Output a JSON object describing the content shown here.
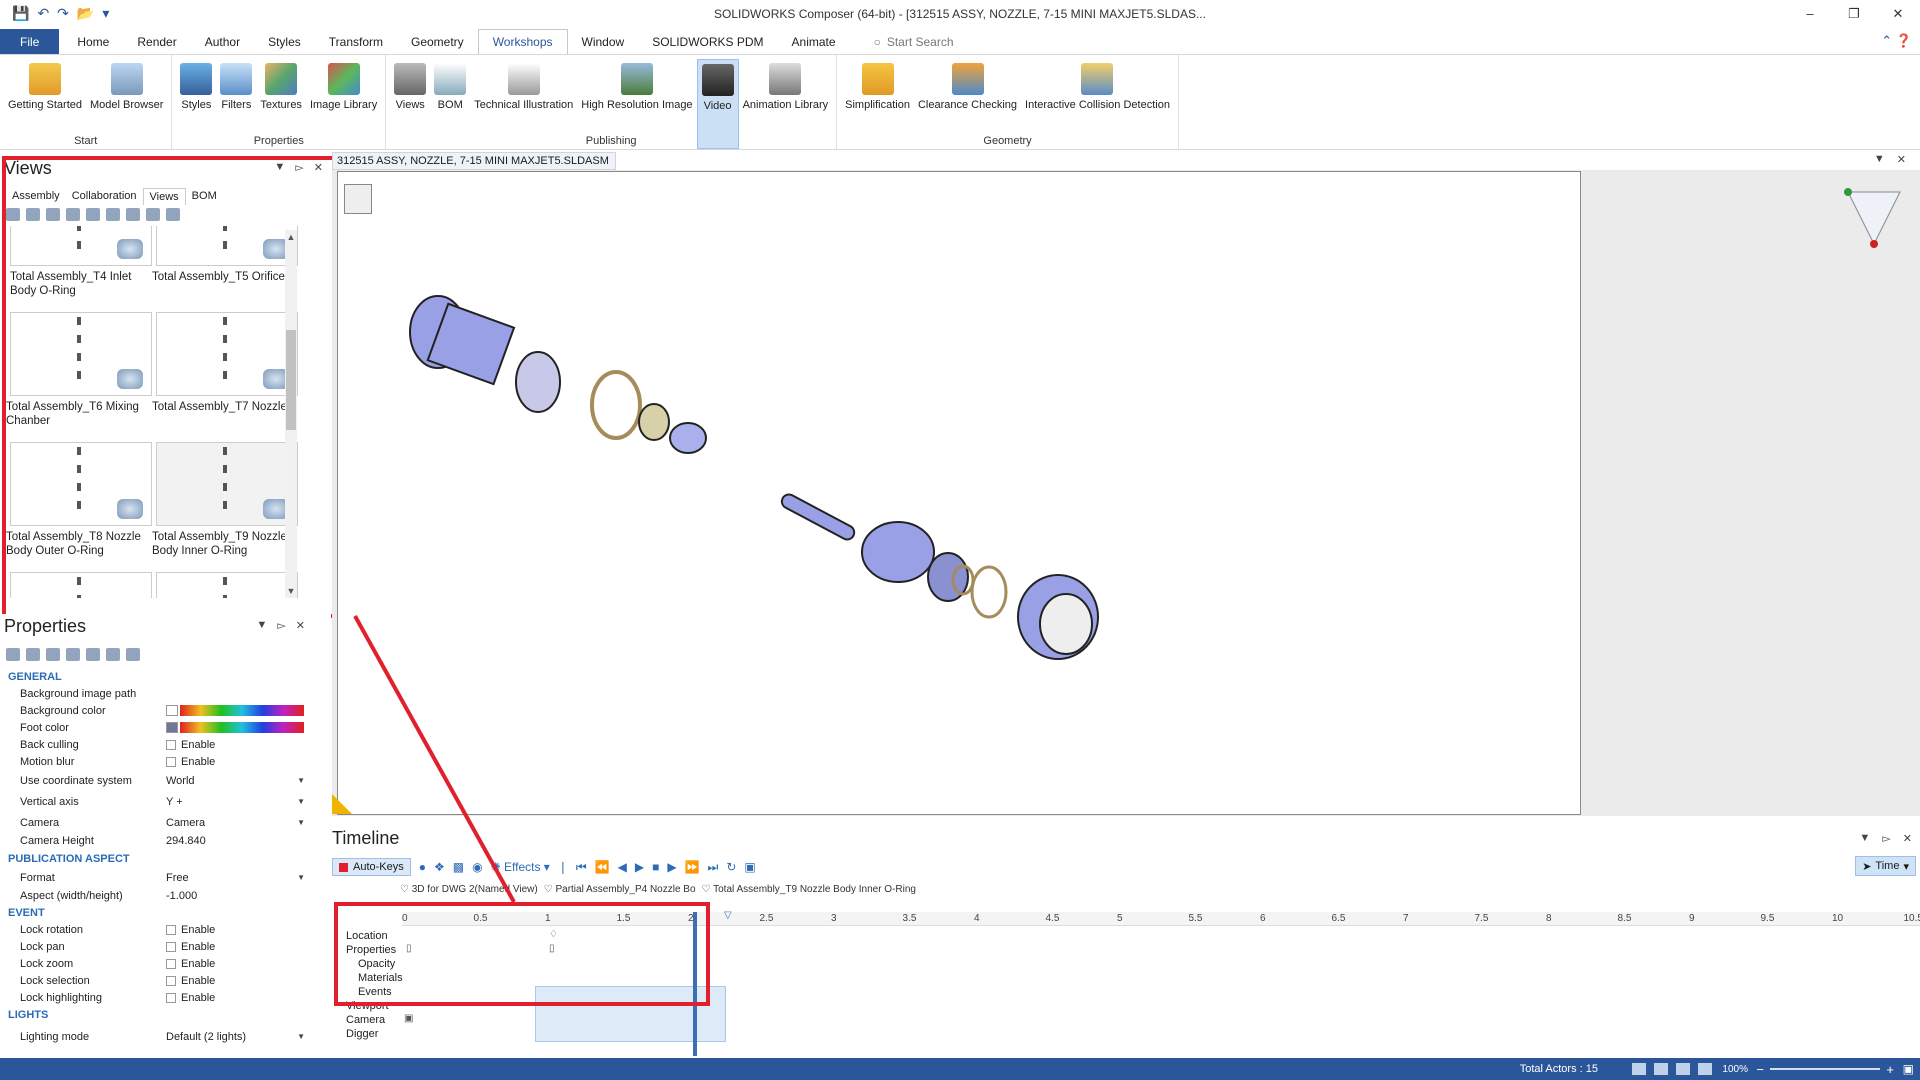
{
  "window": {
    "title": "SOLIDWORKS Composer (64-bit) - [312515 ASSY, NOZZLE, 7-15 MINI MAXJET5.SLDAS..."
  },
  "menu": {
    "tabs": [
      "File",
      "Home",
      "Render",
      "Author",
      "Styles",
      "Transform",
      "Geometry",
      "Workshops",
      "Window",
      "SOLIDWORKS PDM",
      "Animate"
    ],
    "search_placeholder": "Start Search"
  },
  "ribbon": {
    "groups": [
      {
        "label": "Start",
        "buttons": [
          "Getting Started",
          "Model Browser"
        ]
      },
      {
        "label": "Properties",
        "buttons": [
          "Styles",
          "Filters",
          "Textures",
          "Image Library"
        ]
      },
      {
        "label": "Publishing",
        "buttons": [
          "Views",
          "BOM",
          "Technical Illustration",
          "High Resolution Image",
          "Video",
          "Animation Library"
        ]
      },
      {
        "label": "Geometry",
        "buttons": [
          "Simplification",
          "Clearance Checking",
          "Interactive Collision Detection"
        ]
      }
    ]
  },
  "views_panel": {
    "title": "Views",
    "tabs": [
      "Assembly",
      "Collaboration",
      "Views",
      "BOM"
    ],
    "thumbnails": [
      "Total Assembly_T4 Inlet Body O-Ring",
      "Total Assembly_T5 Orifice",
      "Total Assembly_T6 Mixing Chanber",
      "Total Assembly_T7 Nozzle",
      "Total Assembly_T8 Nozzle Body Outer O-Ring",
      "Total Assembly_T9 Nozzle Body Inner O-Ring"
    ]
  },
  "properties_panel": {
    "title": "Properties",
    "sections": {
      "general": "GENERAL",
      "publication": "PUBLICATION ASPECT",
      "event": "EVENT",
      "lights": "LIGHTS"
    },
    "rows": {
      "bg_image_path": "Background image path",
      "bg_color": "Background color",
      "foot_color": "Foot color",
      "back_culling": "Back culling",
      "motion_blur": "Motion blur",
      "coord_system": "Use coordinate system",
      "coord_value": "World",
      "vertical_axis": "Vertical axis",
      "vertical_value": "Y +",
      "camera": "Camera",
      "camera_value": "Camera",
      "camera_height": "Camera Height",
      "camera_height_value": "294.840",
      "format": "Format",
      "format_value": "Free",
      "aspect": "Aspect (width/height)",
      "aspect_value": "-1.000",
      "lock_rotation": "Lock rotation",
      "lock_pan": "Lock pan",
      "lock_zoom": "Lock zoom",
      "lock_selection": "Lock selection",
      "lock_highlighting": "Lock highlighting",
      "lighting_mode": "Lighting mode",
      "lighting_value": "Default (2 lights)",
      "enable": "Enable"
    }
  },
  "document": {
    "tab_title": "312515 ASSY, NOZZLE, 7-15 MINI MAXJET5.SLDASM"
  },
  "timeline": {
    "title": "Timeline",
    "autokeys": "Auto-Keys",
    "effects": "Effects",
    "time_mode": "Time",
    "bookmarks": [
      "3D for DWG 2(Named View)",
      "Partial Assembly_P4 Nozzle Bo",
      "Total Assembly_T9 Nozzle Body Inner O-Ring"
    ],
    "ticks": [
      "0",
      "0.5",
      "1",
      "1.5",
      "2",
      "2.5",
      "3",
      "3.5",
      "4",
      "4.5",
      "5",
      "5.5",
      "6",
      "6.5",
      "7",
      "7.5",
      "8",
      "8.5",
      "9",
      "9.5",
      "10",
      "10.5"
    ],
    "tracks": [
      "Location",
      "Properties",
      "Opacity",
      "Materials",
      "Events",
      "Viewport",
      "Camera",
      "Digger"
    ]
  },
  "status": {
    "actors": "Total Actors : 15",
    "zoom": "100%"
  },
  "colors": {
    "accent": "#2b579a",
    "highlight_box": "#e0202c",
    "part_fill": "#9aa0e6"
  }
}
